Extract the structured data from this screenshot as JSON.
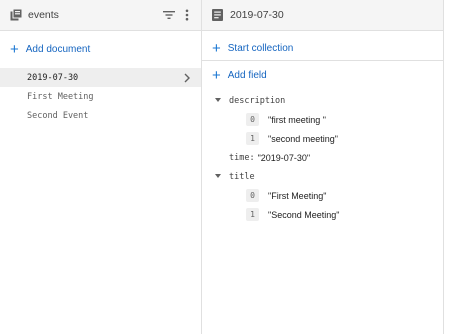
{
  "collection": {
    "title": "events",
    "add_document_label": "Add document",
    "documents": [
      {
        "id": "2019-07-30",
        "selected": true
      },
      {
        "id": "First Meeting",
        "selected": false
      },
      {
        "id": "Second Event",
        "selected": false
      }
    ]
  },
  "document": {
    "title": "2019-07-30",
    "start_collection_label": "Start collection",
    "add_field_label": "Add field",
    "fields": {
      "description": {
        "name": "description",
        "items": [
          {
            "index": "0",
            "value": "\"first meeting \""
          },
          {
            "index": "1",
            "value": "\"second meeting\""
          }
        ]
      },
      "time": {
        "name": "time:",
        "value": "\"2019-07-30\""
      },
      "title": {
        "name": "title",
        "items": [
          {
            "index": "0",
            "value": "\"First Meeting\""
          },
          {
            "index": "1",
            "value": "\"Second Meeting\""
          }
        ]
      }
    }
  },
  "colors": {
    "accent": "#1976d2",
    "header_bg": "#f5f5f5",
    "selected_bg": "#eeeeee"
  },
  "icons": [
    "collection-icon",
    "filter-icon",
    "more-vert-icon",
    "document-icon",
    "plus-icon",
    "chevron-right-icon",
    "expand-caret-icon"
  ]
}
